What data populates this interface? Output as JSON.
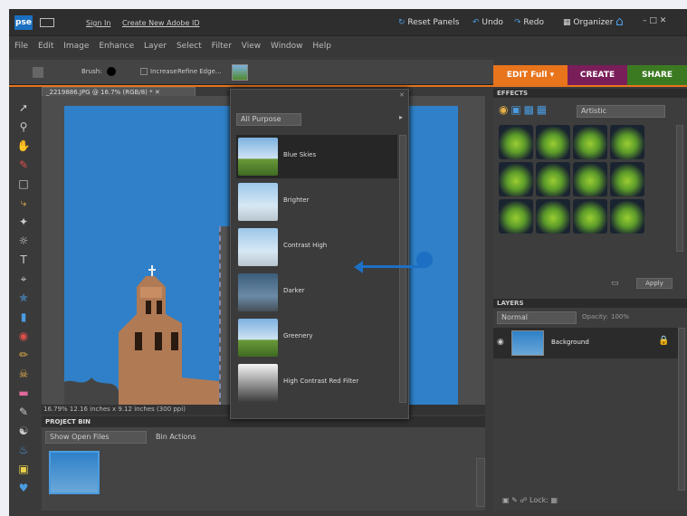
{
  "topbar": {
    "logo": "pse",
    "sign_in": "Sign In",
    "create_id": "Create New Adobe ID",
    "reset_panels": "Reset Panels",
    "undo": "Undo",
    "redo": "Redo",
    "organizer": "Organizer"
  },
  "menu": [
    "File",
    "Edit",
    "Image",
    "Enhance",
    "Layer",
    "Select",
    "Filter",
    "View",
    "Window",
    "Help"
  ],
  "options": {
    "brush_label": "Brush:",
    "increase_label": "Increase",
    "refine_edge": "Refine Edge..."
  },
  "document": {
    "tab_title": "_2219886.JPG @ 16.7% (RGB/8) *",
    "status": "16.79%    12.16 inches x 9.12 inches (300 ppi)"
  },
  "dropdown": {
    "category": "All Purpose",
    "items": [
      {
        "label": "Blue Skies",
        "style": "sky-pic",
        "selected": true
      },
      {
        "label": "Brighter",
        "style": "couple-pic"
      },
      {
        "label": "Contrast High",
        "style": "couple-pic"
      },
      {
        "label": "Darker",
        "style": "couple-dark"
      },
      {
        "label": "Greenery",
        "style": "sky-pic"
      },
      {
        "label": "High Contrast Red Filter",
        "style": "hc-pic"
      }
    ]
  },
  "project_bin": {
    "title": "PROJECT BIN",
    "show": "Show Open Files",
    "bin_actions": "Bin Actions"
  },
  "tabs": {
    "edit": "EDIT Full",
    "create": "CREATE",
    "share": "SHARE"
  },
  "effects": {
    "title": "EFFECTS",
    "category": "Artistic",
    "apply": "Apply"
  },
  "layers": {
    "title": "LAYERS",
    "mode": "Normal",
    "opacity_label": "Opacity:",
    "opacity_value": "100%",
    "layer_name": "Background",
    "lock_label": "Lock:"
  },
  "colors": {
    "accent": "#e8741c",
    "create": "#7a1e5a",
    "share": "#3c7a22",
    "arrow": "#1d6fc4"
  }
}
